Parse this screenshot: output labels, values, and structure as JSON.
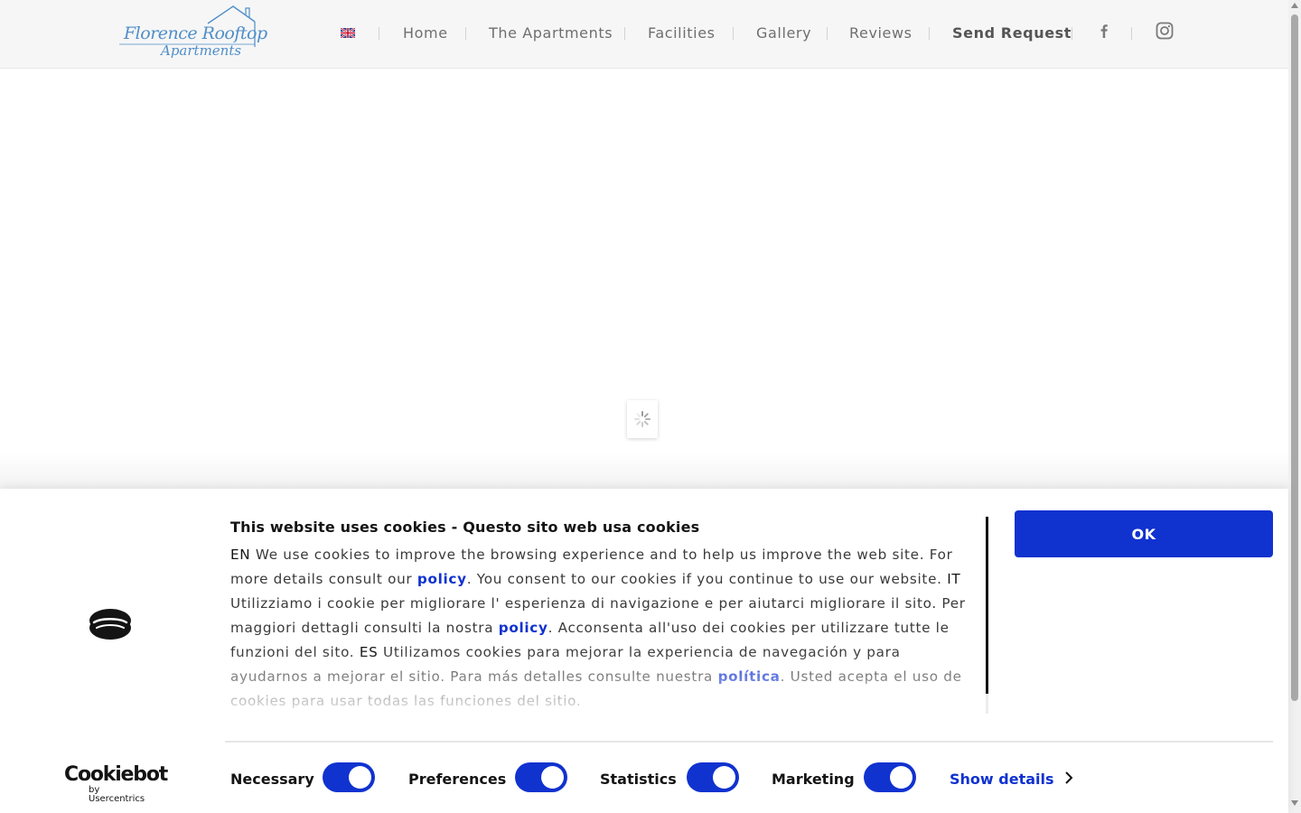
{
  "header": {
    "logo": {
      "line1": "Florence Rooftop",
      "line2": "Apartments"
    },
    "language_flag": "uk-flag-icon",
    "nav": [
      {
        "label": "Home"
      },
      {
        "label": "The Apartments"
      },
      {
        "label": "Facilities"
      },
      {
        "label": "Gallery"
      },
      {
        "label": "Reviews"
      },
      {
        "label": "Send Request"
      }
    ],
    "social": [
      "facebook-icon",
      "instagram-icon"
    ]
  },
  "loader": {
    "icon": "spinner-icon"
  },
  "cookie_banner": {
    "title": "This website uses cookies - Questo sito web usa cookies",
    "body": {
      "en_tag": "EN",
      "en_text_1": " We use cookies to improve the browsing experience and to help us improve the web site. For more details consult our ",
      "en_link": "policy",
      "en_text_2": ". You consent to our cookies if you continue to use our website. ",
      "it_tag": "IT",
      "it_text_1": " Utilizziamo i cookie per migliorare l' esperienza di navigazione e per aiutarci migliorare il sito. Per maggiori dettagli  consulti la nostra ",
      "it_link": "policy",
      "it_text_2": ". Acconsenta all'uso dei cookies per utilizzare tutte le funzioni del sito. ",
      "es_tag": "ES",
      "es_text_1": " Utilizamos cookies para mejorar la experiencia de navegación y para ayudarnos a mejorar el sitio. Para más detalles consulte nuestra ",
      "es_link": "política",
      "es_text_2": ". Usted acepta el uso de cookies para usar todas las funciones del sitio."
    },
    "ok_label": "OK",
    "toggles": [
      {
        "label": "Necessary",
        "checked": true
      },
      {
        "label": "Preferences",
        "checked": true
      },
      {
        "label": "Statistics",
        "checked": true
      },
      {
        "label": "Marketing",
        "checked": true
      }
    ],
    "show_details_label": "Show details",
    "brand": {
      "name": "Cookiebot",
      "sub": "by Usercentrics"
    }
  },
  "colors": {
    "accent": "#1032cf",
    "logo": "#4f8ec9",
    "header_bg": "#f6f6f6"
  }
}
